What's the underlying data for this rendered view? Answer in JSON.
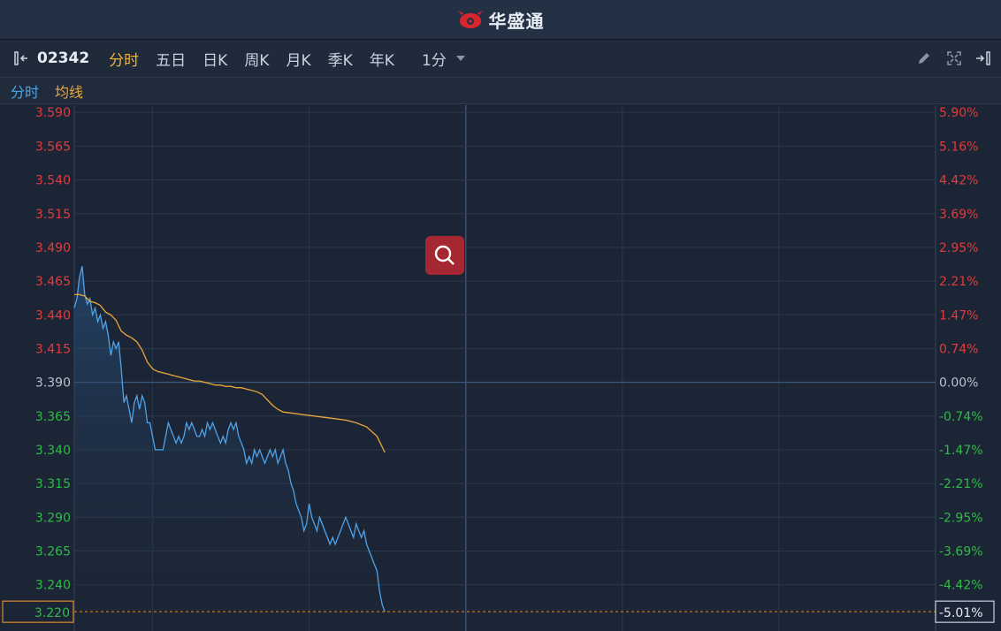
{
  "app": {
    "brand": "华盛通"
  },
  "toolbar": {
    "code": "02342",
    "tabs": [
      "分时",
      "五日",
      "日K",
      "周K",
      "月K",
      "季K",
      "年K"
    ],
    "active_tab": 0,
    "interval": "1分"
  },
  "legend": {
    "price_label": "分时",
    "avg_label": "均线"
  },
  "colors": {
    "up": "#e23b3b",
    "down": "#2fbb45",
    "neutral": "#b9c3d0",
    "price_line": "#4fa3e8",
    "avg_line": "#e9a73d",
    "highlight": "#e0892b"
  },
  "chart_data": {
    "type": "line",
    "ylim": [
      3.2057,
      3.5954
    ],
    "x_range": [
      0,
      330
    ],
    "grid": true,
    "y_ticks": [
      {
        "price": "3.590",
        "pct": "5.90%"
      },
      {
        "price": "3.565",
        "pct": "5.16%"
      },
      {
        "price": "3.540",
        "pct": "4.42%"
      },
      {
        "price": "3.515",
        "pct": "3.69%"
      },
      {
        "price": "3.490",
        "pct": "2.95%"
      },
      {
        "price": "3.465",
        "pct": "2.21%"
      },
      {
        "price": "3.440",
        "pct": "1.47%"
      },
      {
        "price": "3.415",
        "pct": "0.74%"
      },
      {
        "price": "3.390",
        "pct": "0.00%"
      },
      {
        "price": "3.365",
        "pct": "-0.74%"
      },
      {
        "price": "3.340",
        "pct": "-1.47%"
      },
      {
        "price": "3.315",
        "pct": "-2.21%"
      },
      {
        "price": "3.290",
        "pct": "-2.95%"
      },
      {
        "price": "3.265",
        "pct": "-3.69%"
      },
      {
        "price": "3.240",
        "pct": "-4.42%"
      }
    ],
    "prev_close": 3.39,
    "current": {
      "price": "3.220",
      "pct": "-5.01%",
      "value": 3.22
    },
    "series": [
      {
        "name": "分时",
        "points": [
          [
            0,
            3.445
          ],
          [
            1,
            3.452
          ],
          [
            2,
            3.468
          ],
          [
            3,
            3.476
          ],
          [
            4,
            3.455
          ],
          [
            5,
            3.448
          ],
          [
            6,
            3.452
          ],
          [
            7,
            3.44
          ],
          [
            8,
            3.445
          ],
          [
            9,
            3.435
          ],
          [
            10,
            3.44
          ],
          [
            11,
            3.43
          ],
          [
            12,
            3.435
          ],
          [
            13,
            3.425
          ],
          [
            14,
            3.41
          ],
          [
            15,
            3.42
          ],
          [
            16,
            3.415
          ],
          [
            17,
            3.42
          ],
          [
            18,
            3.4
          ],
          [
            19,
            3.375
          ],
          [
            20,
            3.38
          ],
          [
            21,
            3.37
          ],
          [
            22,
            3.36
          ],
          [
            23,
            3.375
          ],
          [
            24,
            3.38
          ],
          [
            25,
            3.37
          ],
          [
            26,
            3.38
          ],
          [
            27,
            3.375
          ],
          [
            28,
            3.36
          ],
          [
            29,
            3.36
          ],
          [
            30,
            3.35
          ],
          [
            31,
            3.34
          ],
          [
            32,
            3.34
          ],
          [
            33,
            3.34
          ],
          [
            34,
            3.34
          ],
          [
            35,
            3.35
          ],
          [
            36,
            3.36
          ],
          [
            37,
            3.355
          ],
          [
            38,
            3.35
          ],
          [
            39,
            3.345
          ],
          [
            40,
            3.35
          ],
          [
            41,
            3.345
          ],
          [
            42,
            3.35
          ],
          [
            43,
            3.36
          ],
          [
            44,
            3.355
          ],
          [
            45,
            3.36
          ],
          [
            46,
            3.355
          ],
          [
            47,
            3.35
          ],
          [
            48,
            3.35
          ],
          [
            49,
            3.355
          ],
          [
            50,
            3.35
          ],
          [
            51,
            3.36
          ],
          [
            52,
            3.355
          ],
          [
            53,
            3.36
          ],
          [
            54,
            3.355
          ],
          [
            55,
            3.35
          ],
          [
            56,
            3.345
          ],
          [
            57,
            3.35
          ],
          [
            58,
            3.345
          ],
          [
            59,
            3.355
          ],
          [
            60,
            3.36
          ],
          [
            61,
            3.355
          ],
          [
            62,
            3.36
          ],
          [
            63,
            3.35
          ],
          [
            64,
            3.345
          ],
          [
            65,
            3.34
          ],
          [
            66,
            3.33
          ],
          [
            67,
            3.335
          ],
          [
            68,
            3.33
          ],
          [
            69,
            3.34
          ],
          [
            70,
            3.335
          ],
          [
            71,
            3.34
          ],
          [
            72,
            3.335
          ],
          [
            73,
            3.33
          ],
          [
            74,
            3.335
          ],
          [
            75,
            3.34
          ],
          [
            76,
            3.335
          ],
          [
            77,
            3.34
          ],
          [
            78,
            3.33
          ],
          [
            79,
            3.335
          ],
          [
            80,
            3.34
          ],
          [
            81,
            3.33
          ],
          [
            82,
            3.325
          ],
          [
            83,
            3.315
          ],
          [
            84,
            3.31
          ],
          [
            85,
            3.3
          ],
          [
            86,
            3.295
          ],
          [
            87,
            3.29
          ],
          [
            88,
            3.28
          ],
          [
            89,
            3.285
          ],
          [
            90,
            3.3
          ],
          [
            91,
            3.29
          ],
          [
            92,
            3.285
          ],
          [
            93,
            3.28
          ],
          [
            94,
            3.29
          ],
          [
            95,
            3.285
          ],
          [
            96,
            3.28
          ],
          [
            97,
            3.275
          ],
          [
            98,
            3.27
          ],
          [
            99,
            3.275
          ],
          [
            100,
            3.27
          ],
          [
            101,
            3.275
          ],
          [
            102,
            3.28
          ],
          [
            103,
            3.285
          ],
          [
            104,
            3.29
          ],
          [
            105,
            3.285
          ],
          [
            106,
            3.28
          ],
          [
            107,
            3.275
          ],
          [
            108,
            3.285
          ],
          [
            109,
            3.28
          ],
          [
            110,
            3.275
          ],
          [
            111,
            3.28
          ],
          [
            112,
            3.27
          ],
          [
            113,
            3.265
          ],
          [
            114,
            3.26
          ],
          [
            115,
            3.255
          ],
          [
            116,
            3.25
          ],
          [
            117,
            3.235
          ],
          [
            118,
            3.225
          ],
          [
            119,
            3.22
          ]
        ]
      },
      {
        "name": "均线",
        "points": [
          [
            0,
            3.455
          ],
          [
            2,
            3.455
          ],
          [
            4,
            3.454
          ],
          [
            6,
            3.45
          ],
          [
            8,
            3.449
          ],
          [
            10,
            3.447
          ],
          [
            12,
            3.442
          ],
          [
            14,
            3.44
          ],
          [
            16,
            3.436
          ],
          [
            18,
            3.428
          ],
          [
            20,
            3.425
          ],
          [
            22,
            3.423
          ],
          [
            24,
            3.42
          ],
          [
            26,
            3.414
          ],
          [
            28,
            3.405
          ],
          [
            30,
            3.4
          ],
          [
            32,
            3.398
          ],
          [
            34,
            3.397
          ],
          [
            36,
            3.396
          ],
          [
            38,
            3.395
          ],
          [
            40,
            3.394
          ],
          [
            42,
            3.393
          ],
          [
            44,
            3.392
          ],
          [
            46,
            3.391
          ],
          [
            48,
            3.391
          ],
          [
            50,
            3.39
          ],
          [
            52,
            3.389
          ],
          [
            54,
            3.388
          ],
          [
            56,
            3.388
          ],
          [
            58,
            3.387
          ],
          [
            60,
            3.387
          ],
          [
            62,
            3.386
          ],
          [
            64,
            3.386
          ],
          [
            66,
            3.385
          ],
          [
            68,
            3.384
          ],
          [
            70,
            3.383
          ],
          [
            72,
            3.381
          ],
          [
            74,
            3.377
          ],
          [
            76,
            3.373
          ],
          [
            78,
            3.37
          ],
          [
            80,
            3.368
          ],
          [
            84,
            3.367
          ],
          [
            88,
            3.366
          ],
          [
            92,
            3.365
          ],
          [
            96,
            3.364
          ],
          [
            100,
            3.363
          ],
          [
            104,
            3.362
          ],
          [
            108,
            3.36
          ],
          [
            112,
            3.357
          ],
          [
            116,
            3.35
          ],
          [
            119,
            3.338
          ]
        ]
      }
    ]
  }
}
